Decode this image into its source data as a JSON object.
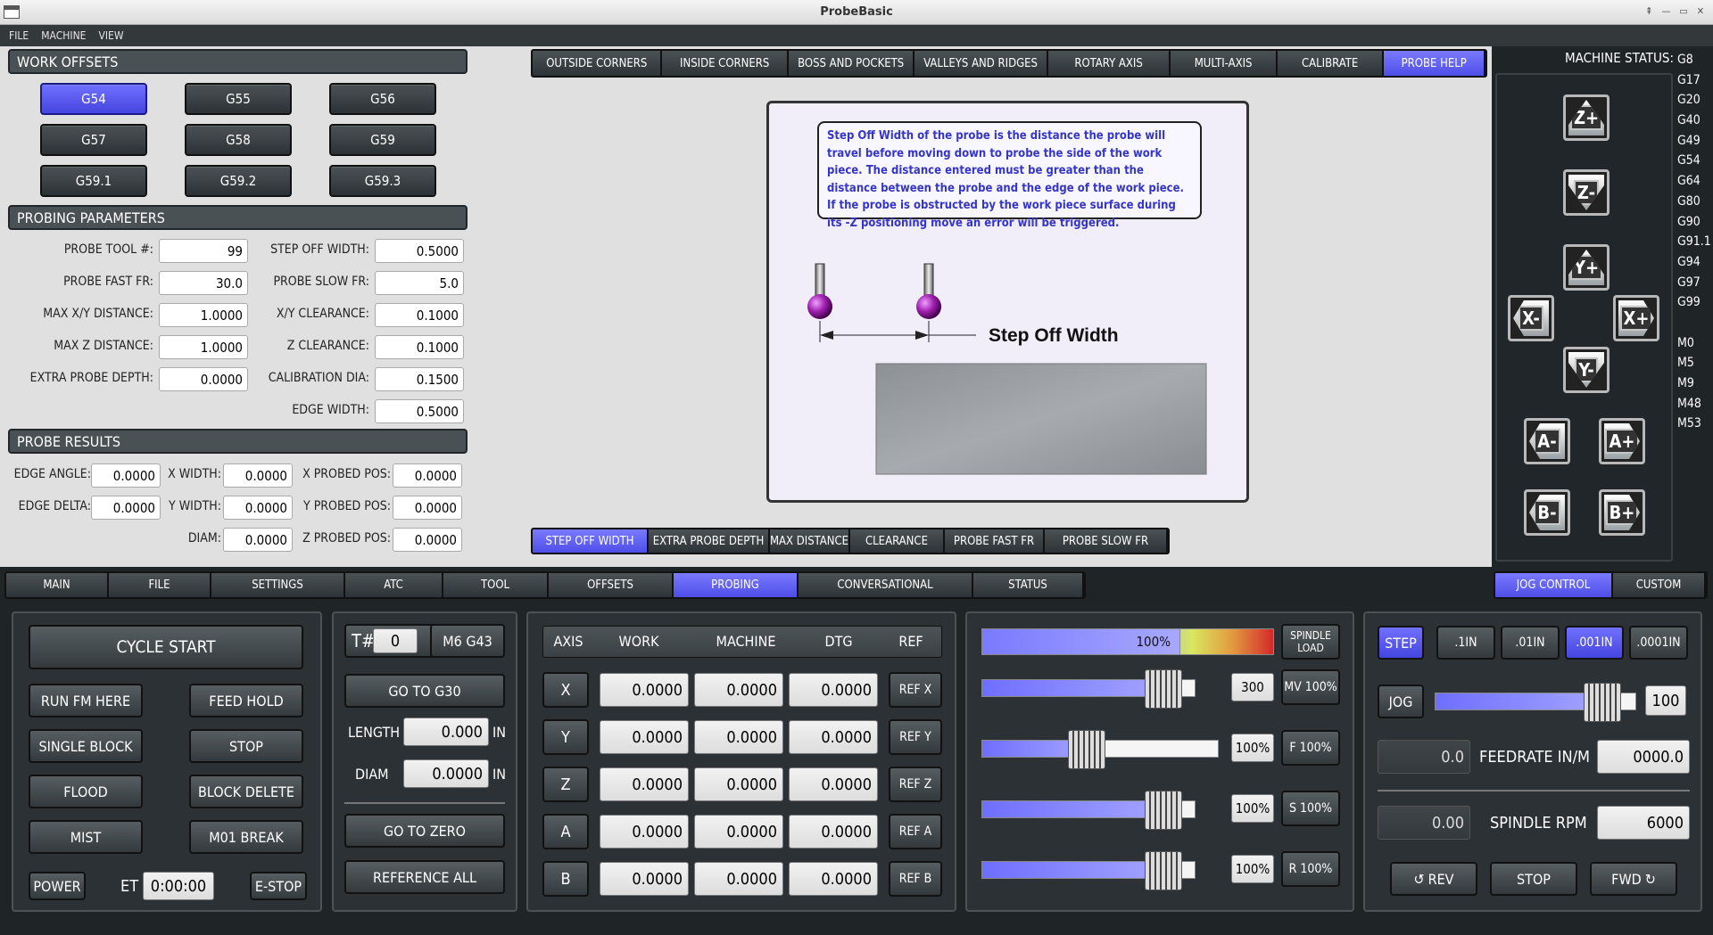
{
  "window": {
    "title": "ProbeBasic"
  },
  "menu": [
    "FILE",
    "MACHINE",
    "VIEW"
  ],
  "work_offsets": {
    "title": "WORK OFFSETS",
    "buttons": [
      "G54",
      "G55",
      "G56",
      "G57",
      "G58",
      "G59",
      "G59.1",
      "G59.2",
      "G59.3"
    ],
    "active": "G54"
  },
  "probing_parameters": {
    "title": "PROBING PARAMETERS",
    "left": [
      {
        "label": "PROBE TOOL #:",
        "value": "99"
      },
      {
        "label": "PROBE FAST FR:",
        "value": "30.0"
      },
      {
        "label": "MAX X/Y DISTANCE:",
        "value": "1.0000"
      },
      {
        "label": "MAX Z DISTANCE:",
        "value": "1.0000"
      },
      {
        "label": "EXTRA PROBE DEPTH:",
        "value": "0.0000"
      }
    ],
    "right": [
      {
        "label": "STEP OFF WIDTH:",
        "value": "0.5000"
      },
      {
        "label": "PROBE SLOW FR:",
        "value": "5.0"
      },
      {
        "label": "X/Y CLEARANCE:",
        "value": "0.1000"
      },
      {
        "label": "Z CLEARANCE:",
        "value": "0.1000"
      },
      {
        "label": "CALIBRATION DIA:",
        "value": "0.1500"
      },
      {
        "label": "EDGE WIDTH:",
        "value": "0.5000"
      }
    ]
  },
  "probe_results": {
    "title": "PROBE RESULTS",
    "rows": [
      [
        {
          "label": "EDGE ANGLE:",
          "value": "0.0000"
        },
        {
          "label": "X WIDTH:",
          "value": "0.0000"
        },
        {
          "label": "X PROBED POS:",
          "value": "0.0000"
        }
      ],
      [
        {
          "label": "EDGE DELTA:",
          "value": "0.0000"
        },
        {
          "label": "Y WIDTH:",
          "value": "0.0000"
        },
        {
          "label": "Y PROBED POS:",
          "value": "0.0000"
        }
      ],
      [
        {
          "label": "",
          "value": ""
        },
        {
          "label": "DIAM:",
          "value": "0.0000"
        },
        {
          "label": "Z PROBED POS:",
          "value": "0.0000"
        }
      ]
    ]
  },
  "probe_tabs": {
    "items": [
      "OUTSIDE CORNERS",
      "INSIDE CORNERS",
      "BOSS AND POCKETS",
      "VALLEYS AND RIDGES",
      "ROTARY AXIS",
      "MULTI-AXIS",
      "CALIBRATE",
      "PROBE HELP"
    ],
    "active": "PROBE HELP"
  },
  "help": {
    "text": "Step Off Width of the probe is the distance the probe will travel before moving down to probe the side of the work piece. The distance entered must be greater than the distance between the probe and the edge of the work piece.  If the probe is obstructed by the work piece surface during its -Z positioning move an error will be triggered.",
    "diagram_label": "Step Off Width"
  },
  "help_tabs": {
    "items": [
      "STEP OFF WIDTH",
      "EXTRA PROBE DEPTH",
      "MAX DISTANCE",
      "CLEARANCE",
      "PROBE FAST FR",
      "PROBE SLOW FR"
    ],
    "active": "STEP OFF WIDTH"
  },
  "machine_status": {
    "title": "MACHINE STATUS:",
    "codes": [
      "G8",
      "G17",
      "G20",
      "G40",
      "G49",
      "G54",
      "G64",
      "G80",
      "G90",
      "G91.1",
      "G94",
      "G97",
      "G99",
      "",
      "M0",
      "M5",
      "M9",
      "M48",
      "M53"
    ]
  },
  "jog_buttons": [
    "Z+",
    "Z-",
    "Y+",
    "X-",
    "X+",
    "Y-",
    "A-",
    "A+",
    "B-",
    "B+"
  ],
  "main_tabs": {
    "items": [
      "MAIN",
      "FILE",
      "SETTINGS",
      "ATC",
      "TOOL",
      "OFFSETS",
      "PROBING",
      "CONVERSATIONAL",
      "STATUS"
    ],
    "active": "PROBING"
  },
  "right_tabs": {
    "items": [
      "JOG CONTROL",
      "CUSTOM"
    ],
    "active": "JOG CONTROL"
  },
  "program_control": {
    "cycle_start": "CYCLE START",
    "run_from_here": "RUN FM HERE",
    "feed_hold": "FEED HOLD",
    "single_block": "SINGLE BLOCK",
    "stop": "STOP",
    "flood": "FLOOD",
    "block_delete": "BLOCK DELETE",
    "mist": "MIST",
    "m01_break": "M01 BREAK",
    "power": "POWER",
    "et_label": "ET",
    "et_value": "0:00:00",
    "estop": "E-STOP"
  },
  "tool_panel": {
    "t_label": "T#",
    "t_value": "0",
    "m6": "M6 G43",
    "go_g30": "GO TO G30",
    "length_label": "LENGTH",
    "length_value": "0.000",
    "length_unit": "IN",
    "diam_label": "DIAM",
    "diam_value": "0.0000",
    "diam_unit": "IN",
    "go_zero": "GO TO ZERO",
    "ref_all": "REFERENCE ALL"
  },
  "dro": {
    "headers": [
      "AXIS",
      "WORK",
      "MACHINE",
      "DTG",
      "REF"
    ],
    "rows": [
      {
        "axis": "X",
        "work": "0.0000",
        "machine": "0.0000",
        "dtg": "0.0000",
        "ref": "REF X"
      },
      {
        "axis": "Y",
        "work": "0.0000",
        "machine": "0.0000",
        "dtg": "0.0000",
        "ref": "REF Y"
      },
      {
        "axis": "Z",
        "work": "0.0000",
        "machine": "0.0000",
        "dtg": "0.0000",
        "ref": "REF Z"
      },
      {
        "axis": "A",
        "work": "0.0000",
        "machine": "0.0000",
        "dtg": "0.0000",
        "ref": "REF A"
      },
      {
        "axis": "B",
        "work": "0.0000",
        "machine": "0.0000",
        "dtg": "0.0000",
        "ref": "REF B"
      }
    ]
  },
  "overrides": {
    "spindle_load": {
      "value": "100%",
      "fraction": 0.68,
      "label_1": "SPINDLE",
      "label_2": "LOAD"
    },
    "sliders": [
      {
        "value": "300",
        "fraction": 0.92,
        "button": "MV 100%"
      },
      {
        "value": "100%",
        "fraction": 0.43,
        "button": "F 100%"
      },
      {
        "value": "100%",
        "fraction": 0.92,
        "button": "S 100%"
      },
      {
        "value": "100%",
        "fraction": 0.92,
        "button": "R 100%"
      }
    ]
  },
  "jog_control": {
    "step": "STEP",
    "increments": [
      ".1IN",
      ".01IN",
      ".001IN",
      ".0001IN"
    ],
    "active_increment": ".001IN",
    "jog": "JOG",
    "jog_value": "100",
    "jog_fraction": 0.9,
    "feed_actual": "0.0",
    "feed_label": "FEEDRATE IN/M",
    "feed_value": "0000.0",
    "spindle_actual": "0.00",
    "spindle_label": "SPINDLE RPM",
    "spindle_value": "6000",
    "rev": "REV",
    "stop": "STOP",
    "fwd": "FWD"
  },
  "colors": {
    "accent": "#5555ee",
    "dark_bg": "#2b3134",
    "panel_bg": "#e0e0e0",
    "help_text": "#3535c8"
  }
}
